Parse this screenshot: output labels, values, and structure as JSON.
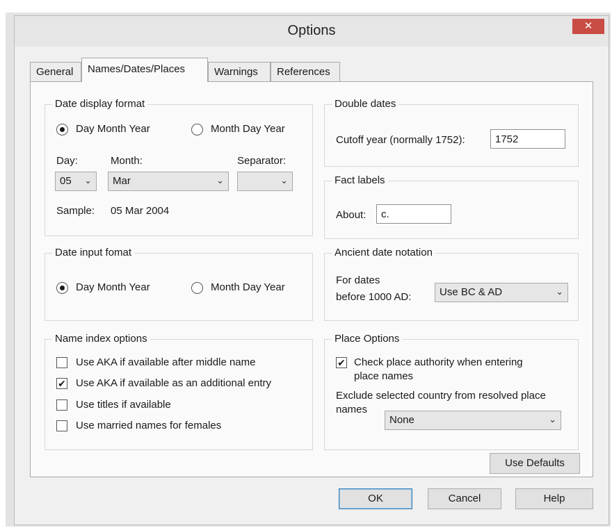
{
  "window": {
    "title": "Options",
    "close_glyph": "✕"
  },
  "tabs": [
    "General",
    "Names/Dates/Places",
    "Warnings",
    "References"
  ],
  "date_display": {
    "title": "Date display format",
    "radio1": "Day Month Year",
    "radio2": "Month Day Year",
    "day_label": "Day:",
    "month_label": "Month:",
    "separator_label": "Separator:",
    "day_value": "05",
    "month_value": "Mar",
    "separator_value": "",
    "sample_label": "Sample:",
    "sample_value": "05 Mar 2004"
  },
  "date_input": {
    "title": "Date input fomat",
    "radio1": "Day Month Year",
    "radio2": "Month Day Year"
  },
  "name_index": {
    "title": "Name index options",
    "items": [
      {
        "label": "Use AKA if available after middle name",
        "checked": false
      },
      {
        "label": "Use AKA if available as an additional entry",
        "checked": true
      },
      {
        "label": "Use titles if available",
        "checked": false
      },
      {
        "label": "Use married names for females",
        "checked": false
      }
    ]
  },
  "double_dates": {
    "title": "Double dates",
    "cutoff_label": "Cutoff year (normally 1752):",
    "cutoff_value": "1752"
  },
  "fact_labels": {
    "title": "Fact labels",
    "about_label": "About:",
    "about_value": "c."
  },
  "ancient": {
    "title": "Ancient date notation",
    "label_line1": "For dates",
    "label_line2": "before 1000 AD:",
    "value": "Use BC & AD"
  },
  "place_options": {
    "title": "Place Options",
    "check_line1": "Check place authority when entering",
    "check_line2": "place names",
    "check_checked": true,
    "exclude_line1": "Exclude selected country from resolved place",
    "exclude_line2": "names",
    "exclude_value": "None"
  },
  "buttons": {
    "use_defaults": "Use Defaults",
    "ok": "OK",
    "cancel": "Cancel",
    "help": "Help"
  },
  "icons": {
    "chevron": "chevron-down-icon",
    "check": "checkmark-icon",
    "close": "close-icon"
  },
  "colors": {
    "close_button": "#c94c45",
    "default_button_border": "#3c7fb1"
  }
}
